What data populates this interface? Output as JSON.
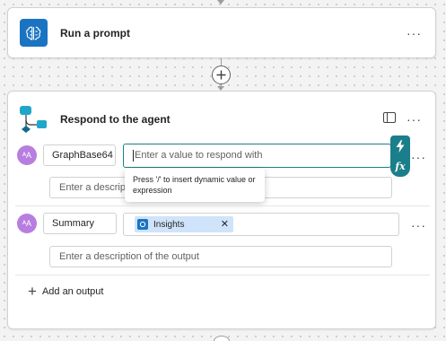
{
  "flow": {
    "actions": [
      {
        "title": "Run a prompt",
        "icon": "brain-icon",
        "icon_color": "#1a74c2"
      },
      {
        "title": "Respond to the agent",
        "icon": "flow-nodes-icon"
      }
    ]
  },
  "respond": {
    "outputs": [
      {
        "avatar_initials": "ᴬA",
        "name": "GraphBase64",
        "value_placeholder": "Enter a value to respond with",
        "description_placeholder": "Enter a description of the output"
      },
      {
        "avatar_initials": "ᴬA",
        "name": "Summary",
        "token_label": "Insights",
        "token_remove": "✕",
        "description_placeholder": "Enter a description of the output"
      }
    ],
    "tooltip": "Press '/' to insert dynamic value or expression",
    "add_output_label": "Add an output",
    "add_output_icon": "+",
    "fx_label": "fx",
    "more_label": "···"
  },
  "colors": {
    "accent_teal": "#1a7f8a",
    "brand_blue": "#1a74c2",
    "avatar_purple": "#b77ee0",
    "token_bg": "#cfe4fa"
  }
}
